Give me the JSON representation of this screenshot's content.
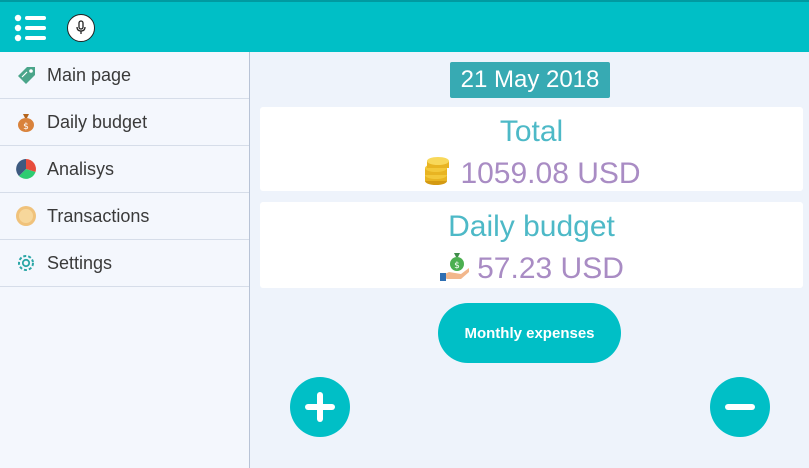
{
  "header": {
    "menu_icon": "list-menu-icon",
    "mic_icon": "microphone-icon",
    "accent_color": "#00bfc6"
  },
  "sidebar": {
    "items": [
      {
        "label": "Main page",
        "icon": "tag-icon"
      },
      {
        "label": "Daily budget",
        "icon": "money-bag-icon"
      },
      {
        "label": "Analisys",
        "icon": "pie-chart-icon"
      },
      {
        "label": "Transactions",
        "icon": "coin-icon"
      },
      {
        "label": "Settings",
        "icon": "gear-icon"
      }
    ]
  },
  "main": {
    "date": "21 May 2018",
    "total": {
      "title": "Total",
      "value": "1059.08 USD",
      "icon": "coin-stack-icon"
    },
    "daily_budget": {
      "title": "Daily budget",
      "value": "57.23 USD",
      "icon": "hand-money-bag-icon"
    },
    "monthly_expenses_label": "Monthly expenses",
    "add_icon": "plus-icon",
    "remove_icon": "minus-icon"
  }
}
